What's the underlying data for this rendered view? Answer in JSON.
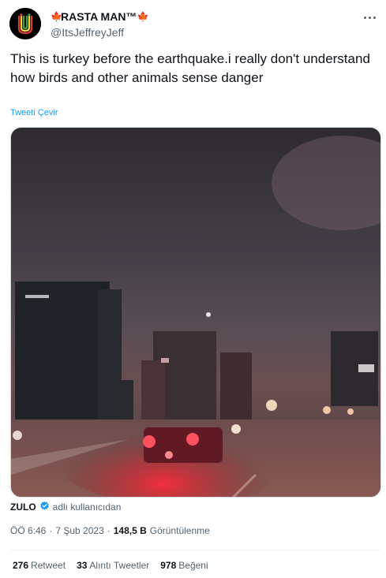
{
  "author": {
    "flag_left": "🍁",
    "display_name": "RASTA MAN™",
    "flag_right": "🍁",
    "handle": "@ItsJeffreyJeff",
    "avatar_icon": "avatar-icon"
  },
  "tweet": {
    "text": "This is turkey before the earthquake.i really don't understand how birds and other animals sense danger",
    "translate_label": "Tweeti Çevir"
  },
  "media_attribution": {
    "name": "ZULO",
    "suffix": "adlı kullanıcıdan"
  },
  "meta": {
    "time": "ÖÖ 6:46",
    "separator": "·",
    "date": "7 Şub 2023",
    "views_count": "148,5 B",
    "views_label": "Görüntülenme"
  },
  "stats": {
    "retweets_count": "276",
    "retweets_label": "Retweet",
    "quotes_count": "33",
    "quotes_label": "Alıntı Tweetler",
    "likes_count": "978",
    "likes_label": "Beğeni"
  },
  "colors": {
    "link": "#1d9bf0",
    "secondary_text": "#536471",
    "primary_text": "#0f1419",
    "verified": "#1d9bf0"
  }
}
